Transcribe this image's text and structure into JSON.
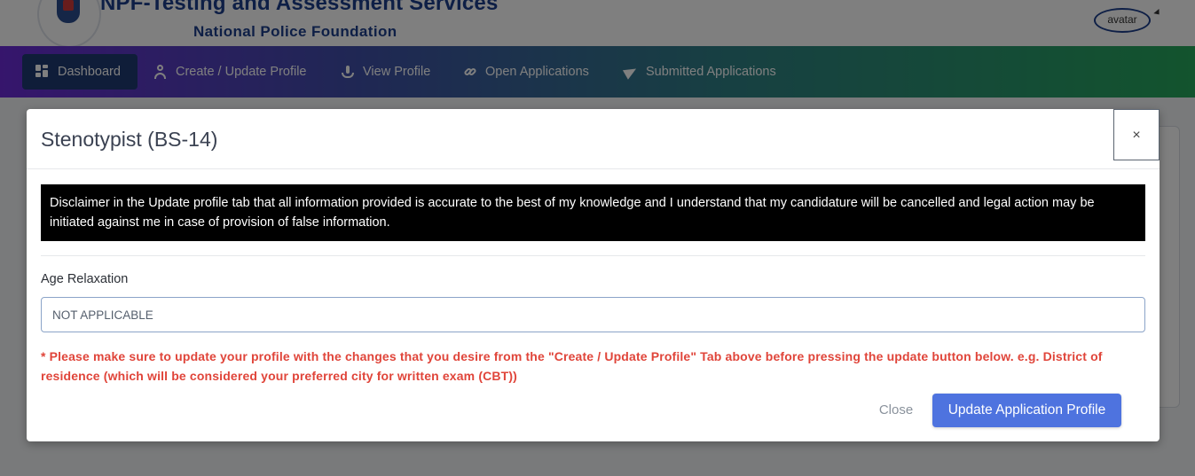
{
  "header": {
    "org_title": "NPF-Testing and Assessment Services",
    "org_subtitle": "National Police Foundation",
    "avatar_alt": "avatar"
  },
  "nav": {
    "items": [
      {
        "label": "Dashboard",
        "icon": "dashboard-grid-icon",
        "active": true
      },
      {
        "label": "Create / Update Profile",
        "icon": "user-icon"
      },
      {
        "label": "View Profile",
        "icon": "view-profile-icon"
      },
      {
        "label": "Open Applications",
        "icon": "link-icon"
      },
      {
        "label": "Submitted Applications",
        "icon": "send-icon"
      }
    ]
  },
  "modal": {
    "title": "Stenotypist (BS-14)",
    "close_x": "×",
    "disclaimer": "Disclaimer in the Update profile tab that all information provided is accurate to the best of my knowledge and I understand that my candidature will be cancelled and legal action may be initiated against me in case of provision of false information.",
    "age_relaxation_label": "Age Relaxation",
    "age_relaxation_value": "NOT APPLICABLE",
    "warning": "* Please make sure to update your profile with the changes that you desire from the \"Create / Update Profile\" Tab above before pressing the update button below. e.g. District of residence (which will be considered your preferred city for written exam (CBT))",
    "close_button": "Close",
    "update_button": "Update Application Profile"
  },
  "colors": {
    "primary_button": "#4e73df",
    "warning_text": "#e0453a",
    "nav_active": "#1f3b73",
    "brand_text": "#1d3f8c"
  }
}
